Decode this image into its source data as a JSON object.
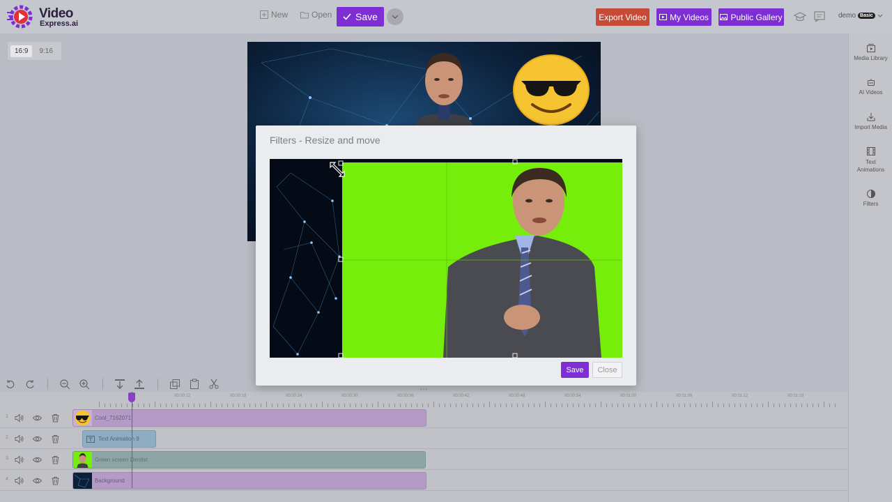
{
  "app": {
    "logo_line1": "Video",
    "logo_line2": "Express.ai"
  },
  "toolbar": {
    "new_label": "New",
    "open_label": "Open",
    "save_label": "Save",
    "export_label": "Export Video",
    "my_videos_label": "My Videos",
    "public_gallery_label": "Public Gallery",
    "user_name": "demo",
    "plan_badge": "Basic"
  },
  "aspect": {
    "options": [
      "16:9",
      "9:16"
    ],
    "selected": "16:9"
  },
  "sidebar": {
    "items": [
      {
        "label": "Media Library",
        "icon": "media-library-icon"
      },
      {
        "label": "AI Videos",
        "icon": "robot-icon"
      },
      {
        "label": "Import Media",
        "icon": "import-icon"
      },
      {
        "label": "Text Animations",
        "icon": "film-icon"
      },
      {
        "label": "Filters",
        "icon": "half-circle-icon"
      }
    ]
  },
  "modal": {
    "title": "Filters - Resize and move",
    "save_label": "Save",
    "close_label": "Close"
  },
  "timeline": {
    "ruler_labels": [
      "00:00:12",
      "00:00:18",
      "00:00:24",
      "00:00:30",
      "00:00:36",
      "00:00:42",
      "00:00:48",
      "00:00:54",
      "00:01:00",
      "00:01:06",
      "00:01:12",
      "00:01:18"
    ],
    "tracks": [
      {
        "index": "1",
        "clip_label": "Cool_7162071"
      },
      {
        "index": "2",
        "clip_label": "Text Animation 9"
      },
      {
        "index": "3",
        "clip_label": "Green screen Dentist"
      },
      {
        "index": "4",
        "clip_label": "Background"
      }
    ]
  },
  "colors": {
    "accent": "#7d2fd4",
    "export": "#c74a37",
    "greenscreen": "#76ee0c"
  }
}
